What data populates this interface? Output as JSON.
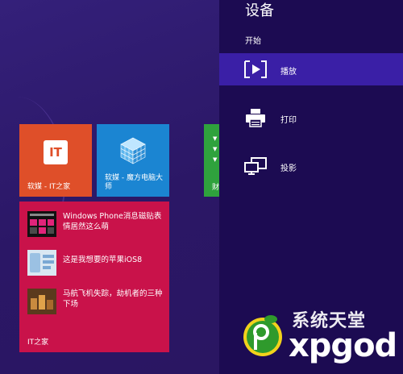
{
  "start_screen": {
    "tiles": {
      "it_home": {
        "logo_text": "IT",
        "label": "软媒 - IT之家",
        "color": "#df4f29"
      },
      "mofang": {
        "label": "软媒 - 魔方电脑大师",
        "color": "#1b85d2"
      },
      "partial_green": {
        "char": "财",
        "color": "#2fa23d"
      },
      "news": {
        "color": "#c9124a",
        "label": "IT之家",
        "items": [
          {
            "text": "Windows Phone消息磁贴表情居然这么萌"
          },
          {
            "text": "这是我想要的苹果iOS8"
          },
          {
            "text": "马航飞机失踪，劫机者的三种下场"
          }
        ]
      }
    }
  },
  "charms": {
    "title": "设备",
    "subtitle": "开始",
    "items": [
      {
        "label": "播放",
        "icon": "play-icon",
        "active": true
      },
      {
        "label": "打印",
        "icon": "printer-icon",
        "active": false
      },
      {
        "label": "投影",
        "icon": "projector-icon",
        "active": false
      }
    ],
    "colors": {
      "panel": "#1c0b52",
      "active_item": "#3a1fa6"
    }
  },
  "watermark": {
    "line1": "系统天堂",
    "line2": "xpgod"
  }
}
